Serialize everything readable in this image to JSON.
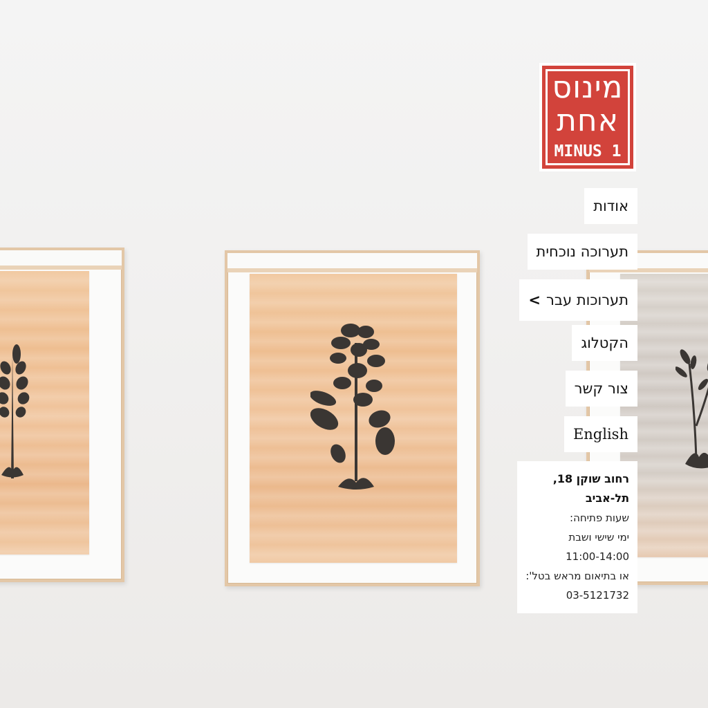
{
  "logo": {
    "hebrew_top": "מינוס",
    "hebrew_bottom": "אחת",
    "latin": "MINUS 1",
    "brand_color": "#d2433b"
  },
  "menu": {
    "items": [
      {
        "label": "אודות"
      },
      {
        "label": "תערוכה נוכחית"
      },
      {
        "label": "תערוכות עבר",
        "arrow": ">"
      },
      {
        "label": "הקטלוג"
      },
      {
        "label": "צור קשר"
      },
      {
        "label": "English"
      }
    ]
  },
  "info": {
    "address": "רחוב שוקן 18, תל-אביב",
    "hours_title": "שעות פתיחה:",
    "days": "ימי שישי ושבת",
    "hours": "11:00-14:00",
    "coordination": "או בתיאום מראש בטל':",
    "phone": "03-5121732"
  },
  "artworks": [
    {
      "subject": "fern-plant-silhouette",
      "paper_color": "#eebd8f"
    },
    {
      "subject": "flowering-plant-silhouette",
      "paper_color": "#eebd8f"
    },
    {
      "subject": "branching-plant-silhouette",
      "paper_color": "#d4cdc6"
    }
  ]
}
